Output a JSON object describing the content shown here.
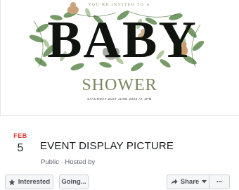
{
  "cover": {
    "invite_text": "YOU'RE INVITED TO A",
    "word_baby": "BABY",
    "word_shower": "SHOWER",
    "date_text": "SATURDAY 21ST JUNE 2023 AT 1PM"
  },
  "event": {
    "month": "FEB",
    "day": "5",
    "title": "EVENT DISPLAY PICTURE",
    "privacy": "Public",
    "hosted_by": "Hosted by"
  },
  "actions": {
    "interested_label": "Interested",
    "going_label": "Going...",
    "share_label": "Share",
    "more_label": "•••"
  },
  "icons": {
    "interested": "star-icon",
    "share": "share-arrow-icon",
    "share_dropdown": "caret-down-icon",
    "more": "more-dots-icon"
  },
  "colors": {
    "month_accent": "#e03b30",
    "title_text": "#1c1e21",
    "muted_text": "#606770",
    "button_bg": "#f5f6f7",
    "button_border": "#ccd0d5",
    "shower_text": "#78865f",
    "foliage": "#5f8a4e"
  }
}
